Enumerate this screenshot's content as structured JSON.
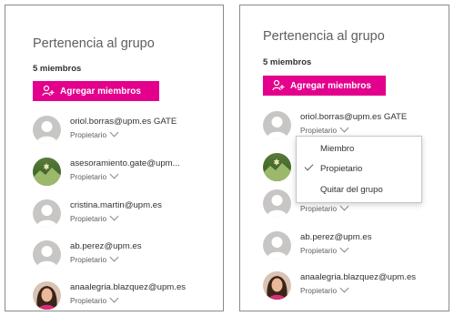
{
  "colors": {
    "accent": "#e3008c"
  },
  "left": {
    "title": "Pertenencia al grupo",
    "member_count": "5 miembros",
    "add_button": "Agregar miembros",
    "members": [
      {
        "email": "oriol.borras@upm.es GATE",
        "role": "Propietario",
        "avatar": "default-person-icon"
      },
      {
        "email": "asesoramiento.gate@upm...",
        "role": "Propietario",
        "avatar": "landscape-photo"
      },
      {
        "email": "cristina.martin@upm.es",
        "role": "Propietario",
        "avatar": "default-person-icon"
      },
      {
        "email": "ab.perez@upm.es",
        "role": "Propietario",
        "avatar": "default-person-icon"
      },
      {
        "email": "anaalegria.blazquez@upm.es",
        "role": "Propietario",
        "avatar": "person-photo"
      }
    ]
  },
  "right": {
    "title": "Pertenencia al grupo",
    "member_count": "5 miembros",
    "add_button": "Agregar miembros",
    "members": [
      {
        "email": "oriol.borras@upm.es GATE",
        "role": "Propietario"
      },
      {
        "email": "",
        "role": "Propietario"
      },
      {
        "email": "",
        "role": "Propietario"
      },
      {
        "email": "ab.perez@upm.es",
        "role": "Propietario"
      },
      {
        "email": "anaalegria.blazquez@upm.es",
        "role": "Propietario"
      }
    ],
    "role_menu": {
      "options": [
        "Miembro",
        "Propietario",
        "Quitar del grupo"
      ],
      "selected": "Propietario"
    }
  }
}
